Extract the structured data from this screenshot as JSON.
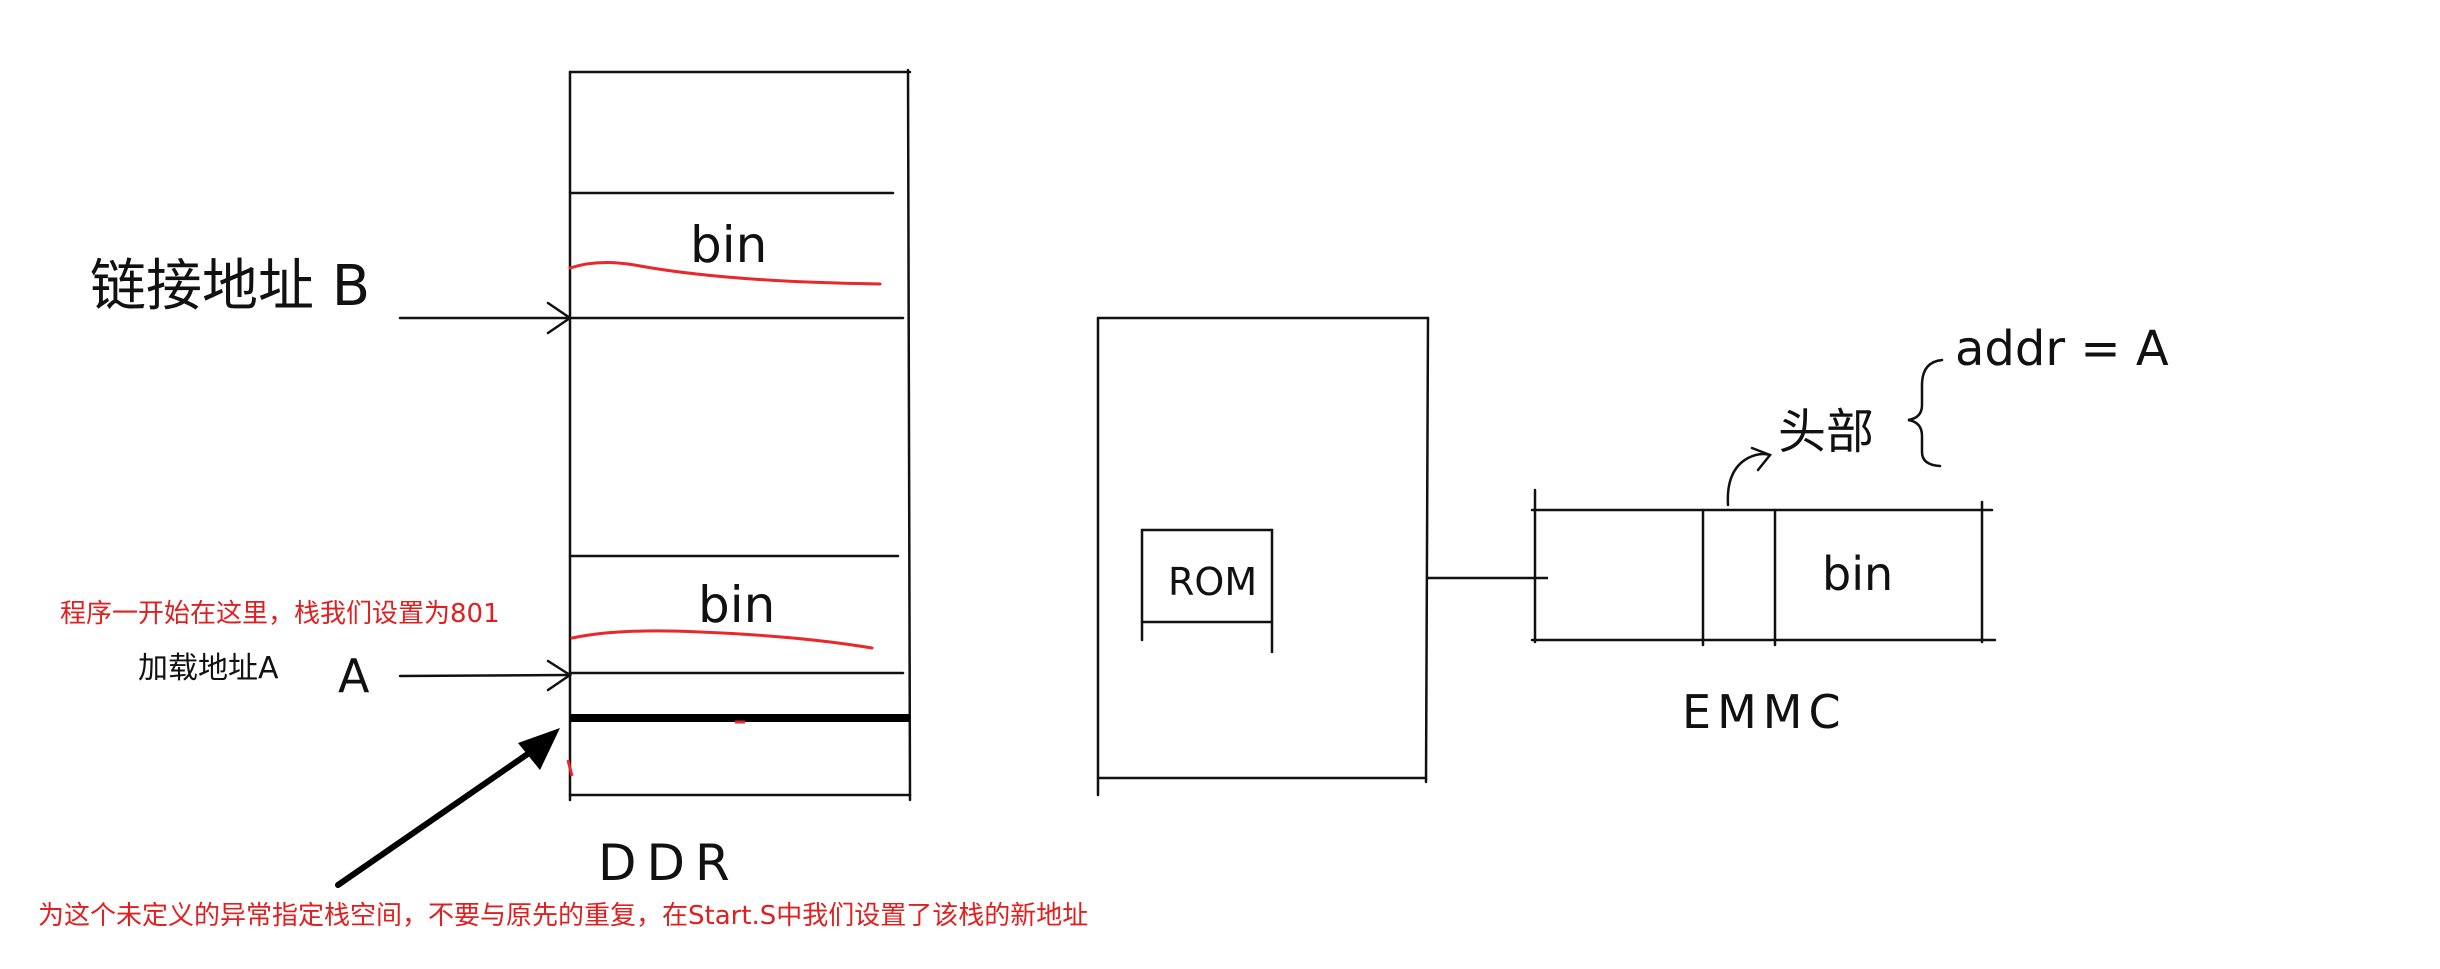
{
  "colors": {
    "ink": "#111111",
    "red": "#e8282a",
    "annotation_red": "#e02020",
    "background": "#ffffff"
  },
  "ddr": {
    "caption": "DDR",
    "top_bin_label": "bin",
    "bottom_bin_label": "bin"
  },
  "link_address": {
    "label": "链接地址 B"
  },
  "load_address": {
    "label": "加载地址A",
    "letter": "A"
  },
  "annotations": {
    "program_start": "程序一开始在这里，栈我们设置为801",
    "undefined_stack": "为这个未定义的异常指定栈空间，不要与原先的重复，在Start.S中我们设置了该栈的新地址"
  },
  "soc": {
    "rom_label": "ROM"
  },
  "emmc": {
    "caption": "EMMC",
    "bin_label": "bin",
    "header_label": "头部",
    "header_note": "addr = A"
  }
}
